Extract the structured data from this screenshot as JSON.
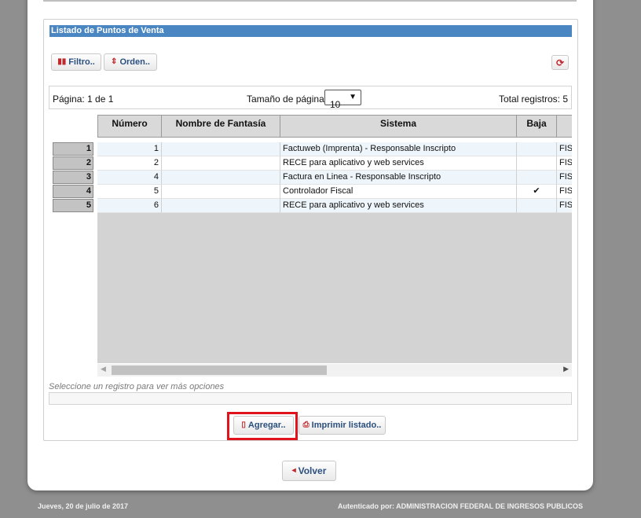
{
  "panel": {
    "title": "Listado de Puntos de Venta"
  },
  "toolbar": {
    "filter_label": "Filtro..",
    "order_label": "Orden..",
    "refresh_icon": "refresh-icon"
  },
  "pager": {
    "page_label": "Página: 1 de 1",
    "page_size_label": "Tamaño de página:",
    "page_size_value": "10",
    "total_label": "Total registros: 5"
  },
  "grid": {
    "columns": [
      "Número",
      "Nombre de Fantasía",
      "Sistema",
      "Baja",
      ""
    ],
    "rows": [
      {
        "n": "1",
        "numero": "1",
        "nombre": "",
        "sistema": "Factuweb (Imprenta) - Responsable Inscripto",
        "baja": "",
        "extra": "FIS"
      },
      {
        "n": "2",
        "numero": "2",
        "nombre": "",
        "sistema": "RECE para aplicativo y web services",
        "baja": "",
        "extra": "FIS"
      },
      {
        "n": "3",
        "numero": "4",
        "nombre": "",
        "sistema": "Factura en Linea - Responsable Inscripto",
        "baja": "",
        "extra": "FIS"
      },
      {
        "n": "4",
        "numero": "5",
        "nombre": "",
        "sistema": "Controlador Fiscal",
        "baja": "✔",
        "extra": "FIS"
      },
      {
        "n": "5",
        "numero": "6",
        "nombre": "",
        "sistema": "RECE para aplicativo y web services",
        "baja": "",
        "extra": "FIS"
      }
    ]
  },
  "hint": "Seleccione un registro para ver más opciones",
  "actions": {
    "add_label": "Agregar..",
    "print_label": "Imprimir listado.."
  },
  "back_label": "Volver",
  "footer": {
    "date": "Jueves, 20 de julio de 2017",
    "auth": "Autenticado por: ADMINISTRACION FEDERAL DE INGRESOS PUBLICOS"
  },
  "colors": {
    "title_bar": "#4a86c1",
    "highlight": "#e0141c",
    "background": "#8f8f8f"
  }
}
